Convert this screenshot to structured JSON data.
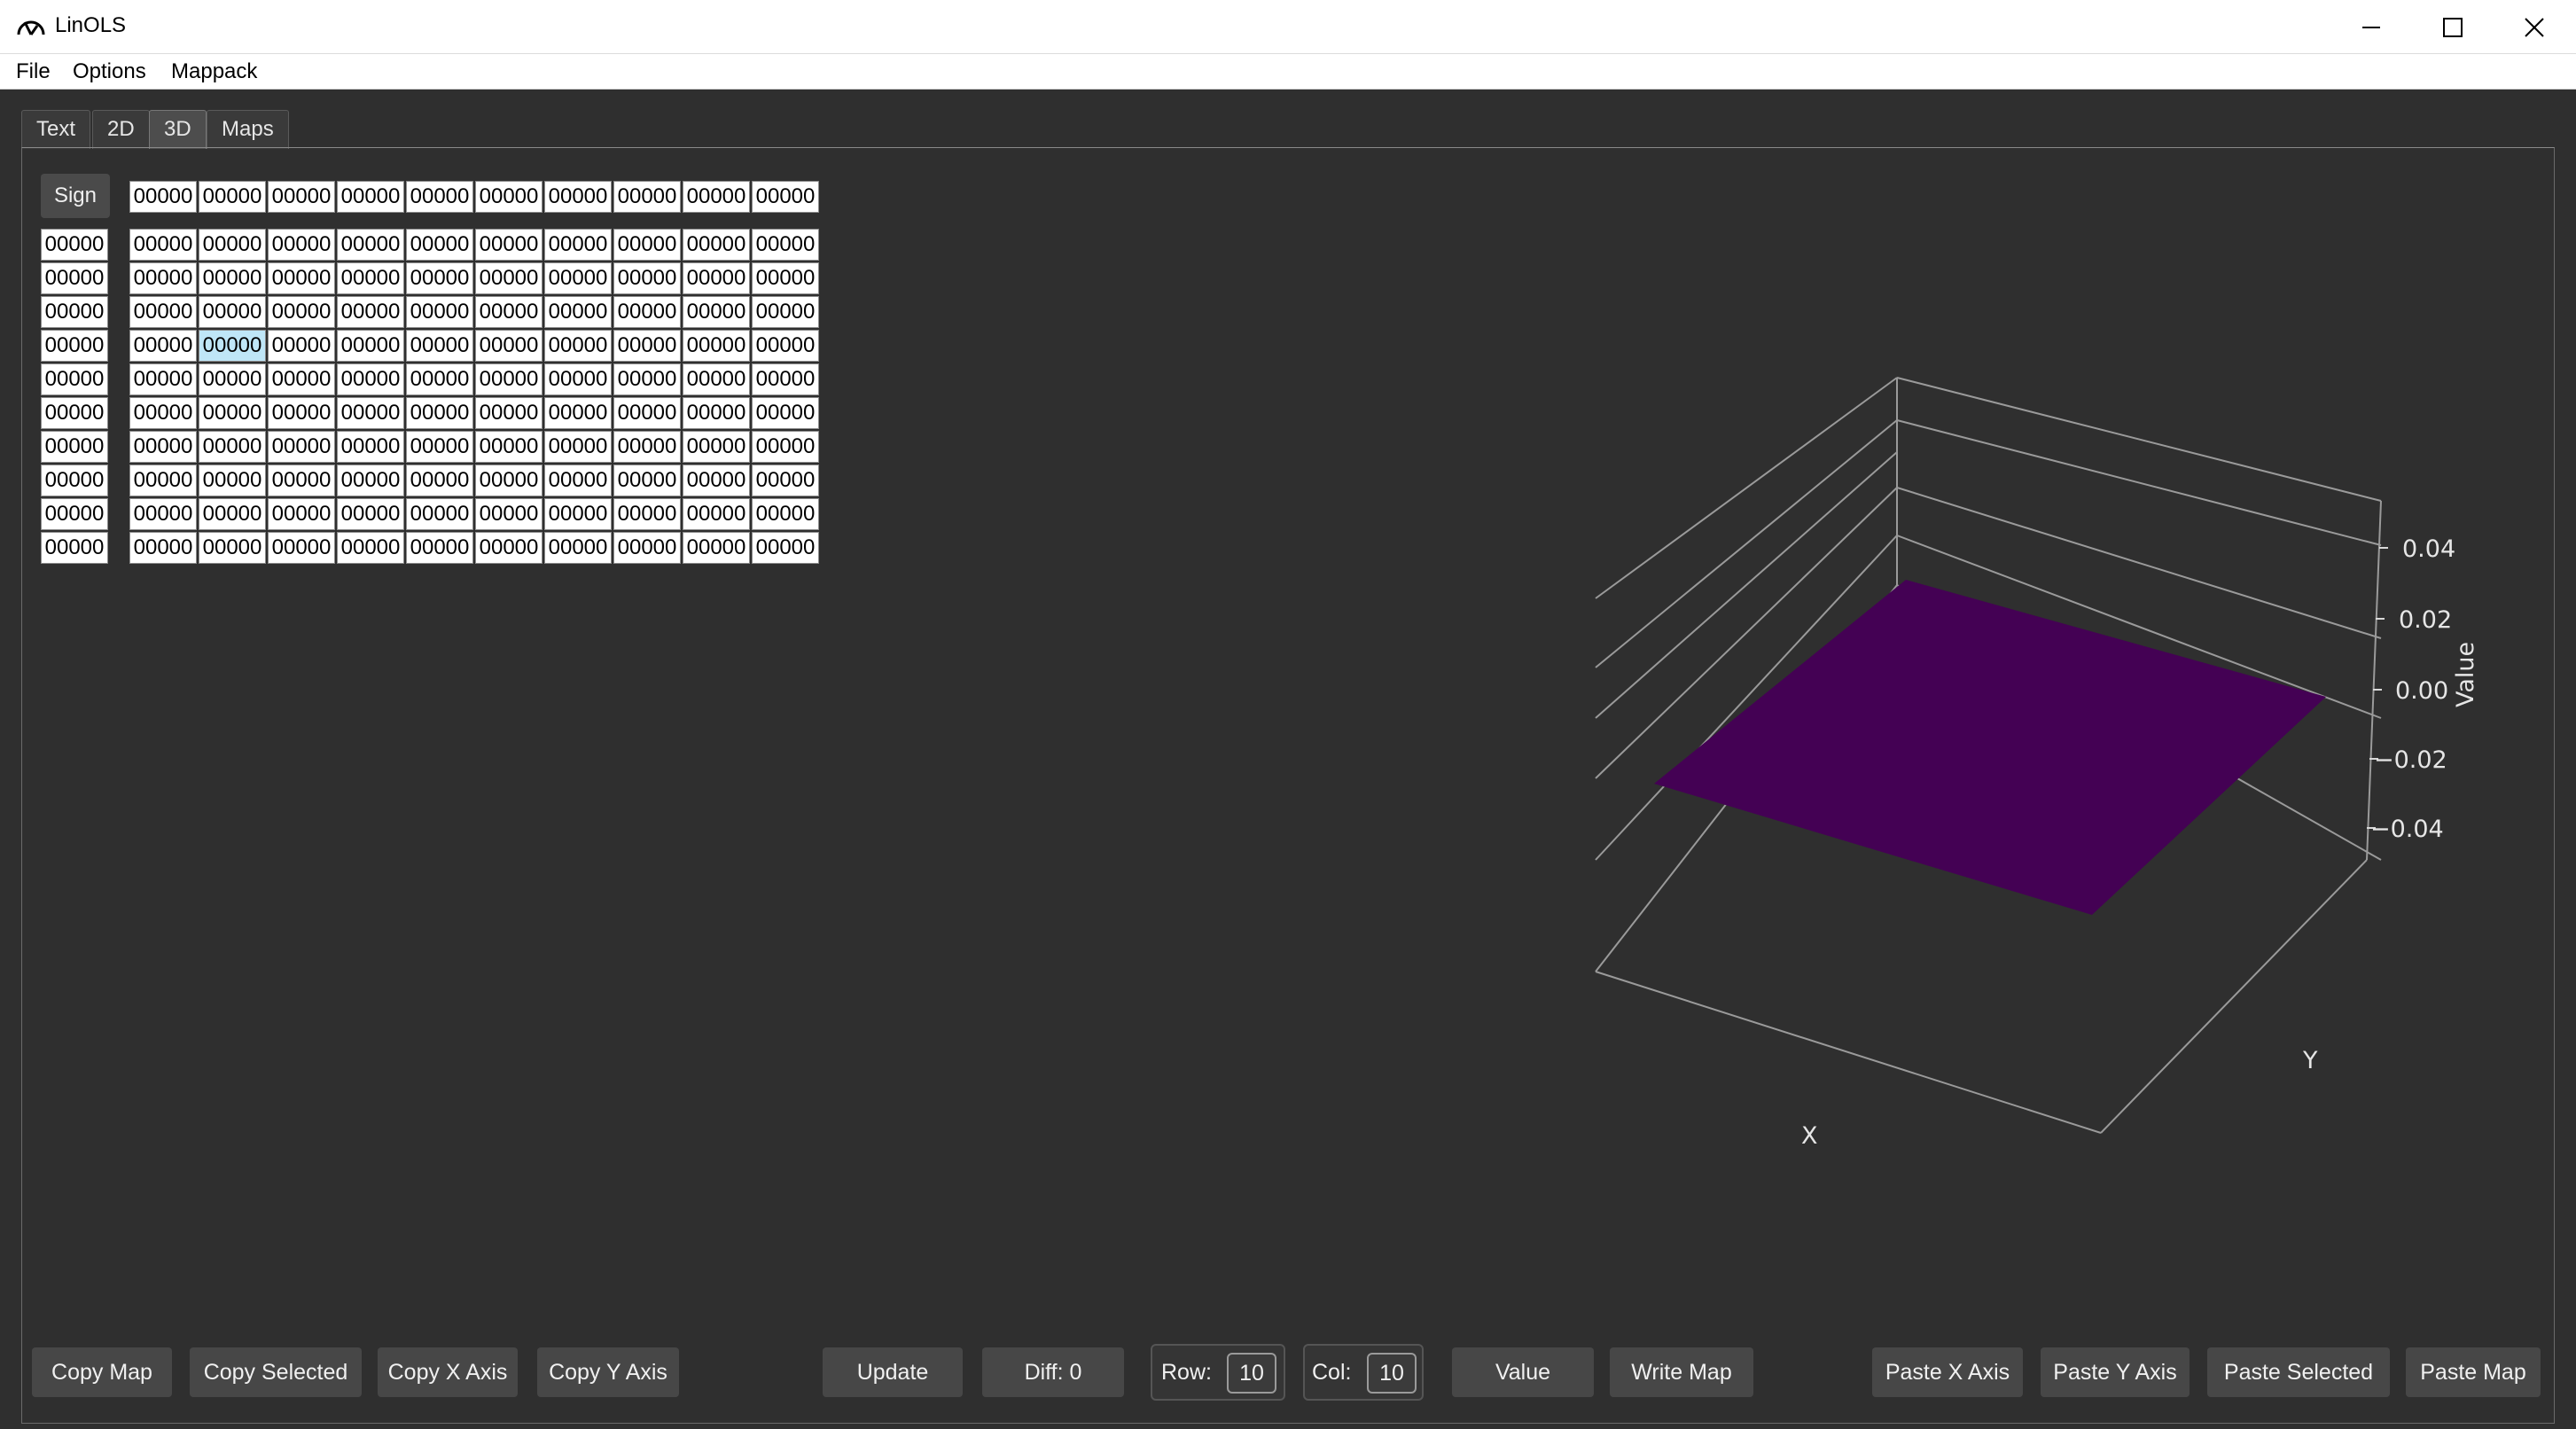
{
  "window": {
    "title": "LinOLS",
    "icons": {
      "app": "gauge-icon",
      "minimize": "minimize-icon",
      "maximize": "maximize-icon",
      "close": "close-icon"
    }
  },
  "menu": [
    "File",
    "Options",
    "Mappack"
  ],
  "tabs": [
    {
      "label": "Text",
      "active": false
    },
    {
      "label": "2D",
      "active": false
    },
    {
      "label": "3D",
      "active": true
    },
    {
      "label": "Maps",
      "active": false
    }
  ],
  "table": {
    "sign_label": "Sign",
    "x_axis": [
      "00000",
      "00000",
      "00000",
      "00000",
      "00000",
      "00000",
      "00000",
      "00000",
      "00000",
      "00000"
    ],
    "y_axis": [
      "00000",
      "00000",
      "00000",
      "00000",
      "00000",
      "00000",
      "00000",
      "00000",
      "00000",
      "00000"
    ],
    "rows": [
      [
        "00000",
        "00000",
        "00000",
        "00000",
        "00000",
        "00000",
        "00000",
        "00000",
        "00000",
        "00000"
      ],
      [
        "00000",
        "00000",
        "00000",
        "00000",
        "00000",
        "00000",
        "00000",
        "00000",
        "00000",
        "00000"
      ],
      [
        "00000",
        "00000",
        "00000",
        "00000",
        "00000",
        "00000",
        "00000",
        "00000",
        "00000",
        "00000"
      ],
      [
        "00000",
        "00000",
        "00000",
        "00000",
        "00000",
        "00000",
        "00000",
        "00000",
        "00000",
        "00000"
      ],
      [
        "00000",
        "00000",
        "00000",
        "00000",
        "00000",
        "00000",
        "00000",
        "00000",
        "00000",
        "00000"
      ],
      [
        "00000",
        "00000",
        "00000",
        "00000",
        "00000",
        "00000",
        "00000",
        "00000",
        "00000",
        "00000"
      ],
      [
        "00000",
        "00000",
        "00000",
        "00000",
        "00000",
        "00000",
        "00000",
        "00000",
        "00000",
        "00000"
      ],
      [
        "00000",
        "00000",
        "00000",
        "00000",
        "00000",
        "00000",
        "00000",
        "00000",
        "00000",
        "00000"
      ],
      [
        "00000",
        "00000",
        "00000",
        "00000",
        "00000",
        "00000",
        "00000",
        "00000",
        "00000",
        "00000"
      ],
      [
        "00000",
        "00000",
        "00000",
        "00000",
        "00000",
        "00000",
        "00000",
        "00000",
        "00000",
        "00000"
      ]
    ],
    "selected": {
      "row": 3,
      "col": 1
    }
  },
  "plot3d": {
    "xlabel": "X",
    "ylabel": "Y",
    "zlabel": "Value",
    "z_ticks": [
      "0.04",
      "0.02",
      "0.00",
      "−0.02",
      "−0.04"
    ],
    "surface_color": "#440154"
  },
  "toolbar": {
    "copy_map": "Copy Map",
    "copy_selected": "Copy Selected",
    "copy_x_axis": "Copy X Axis",
    "copy_y_axis": "Copy Y Axis",
    "update": "Update",
    "diff": "Diff: 0",
    "row_label": "Row:",
    "row_value": "10",
    "col_label": "Col:",
    "col_value": "10",
    "value": "Value",
    "write_map": "Write Map",
    "paste_x_axis": "Paste X Axis",
    "paste_y_axis": "Paste Y Axis",
    "paste_selected": "Paste Selected",
    "paste_map": "Paste Map"
  }
}
